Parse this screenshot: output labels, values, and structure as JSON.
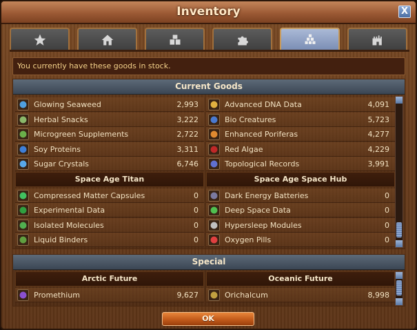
{
  "window": {
    "title": "Inventory",
    "close_label": "X"
  },
  "tabs": [
    {
      "name": "star-icon"
    },
    {
      "name": "house-icon"
    },
    {
      "name": "crates-icon"
    },
    {
      "name": "puzzle-icon"
    },
    {
      "name": "goods-bricks-icon",
      "active": true
    },
    {
      "name": "castle-icon"
    }
  ],
  "info": {
    "text": "You currently have these goods in stock."
  },
  "current_goods": {
    "header": "Current Goods",
    "left": [
      {
        "name": "Glowing Seaweed",
        "amount": "2,993",
        "icon": "seaweed-icon",
        "color": "#4fa0e0"
      },
      {
        "name": "Herbal Snacks",
        "amount": "3,222",
        "icon": "herbal-snacks-icon",
        "color": "#8ab86a"
      },
      {
        "name": "Microgreen Supplements",
        "amount": "2,722",
        "icon": "microgreen-icon",
        "color": "#6ab04a"
      },
      {
        "name": "Soy Proteins",
        "amount": "3,311",
        "icon": "soy-proteins-icon",
        "color": "#3e7fd8"
      },
      {
        "name": "Sugar Crystals",
        "amount": "6,746",
        "icon": "sugar-crystals-icon",
        "color": "#58a8e8"
      }
    ],
    "right": [
      {
        "name": "Advanced DNA Data",
        "amount": "4,091",
        "icon": "dna-icon",
        "color": "#e0b040"
      },
      {
        "name": "Bio Creatures",
        "amount": "5,723",
        "icon": "bio-creatures-icon",
        "color": "#4a7ad0"
      },
      {
        "name": "Enhanced Poriferas",
        "amount": "4,277",
        "icon": "poriferas-icon",
        "color": "#e08a30"
      },
      {
        "name": "Red Algae",
        "amount": "4,229",
        "icon": "red-algae-icon",
        "color": "#c02828"
      },
      {
        "name": "Topological Records",
        "amount": "3,991",
        "icon": "topological-records-icon",
        "color": "#6070d0"
      }
    ],
    "left_sub": {
      "title": "Space Age Titan",
      "items": [
        {
          "name": "Compressed Matter Capsules",
          "amount": "0",
          "icon": "capsules-icon",
          "color": "#40c060"
        },
        {
          "name": "Experimental Data",
          "amount": "0",
          "icon": "experimental-data-icon",
          "color": "#30a040"
        },
        {
          "name": "Isolated Molecules",
          "amount": "0",
          "icon": "molecules-icon",
          "color": "#50b050"
        },
        {
          "name": "Liquid Binders",
          "amount": "0",
          "icon": "liquid-binders-icon",
          "color": "#60a040"
        }
      ]
    },
    "right_sub": {
      "title": "Space Age Space Hub",
      "items": [
        {
          "name": "Dark Energy Batteries",
          "amount": "0",
          "icon": "batteries-icon",
          "color": "#7a7aa0"
        },
        {
          "name": "Deep Space Data",
          "amount": "0",
          "icon": "deep-space-data-icon",
          "color": "#50c050"
        },
        {
          "name": "Hypersleep Modules",
          "amount": "0",
          "icon": "hypersleep-icon",
          "color": "#c0c0c0"
        },
        {
          "name": "Oxygen Pills",
          "amount": "0",
          "icon": "oxygen-pills-icon",
          "color": "#e04040"
        }
      ]
    }
  },
  "special": {
    "header": "Special",
    "left_title": "Arctic Future",
    "right_title": "Oceanic Future",
    "left_items": [
      {
        "name": "Promethium",
        "amount": "9,627",
        "icon": "promethium-icon",
        "color": "#8a50d0"
      }
    ],
    "right_items": [
      {
        "name": "Orichalcum",
        "amount": "8,998",
        "icon": "orichalcum-icon",
        "color": "#c0a040"
      }
    ]
  },
  "ok_label": "OK"
}
